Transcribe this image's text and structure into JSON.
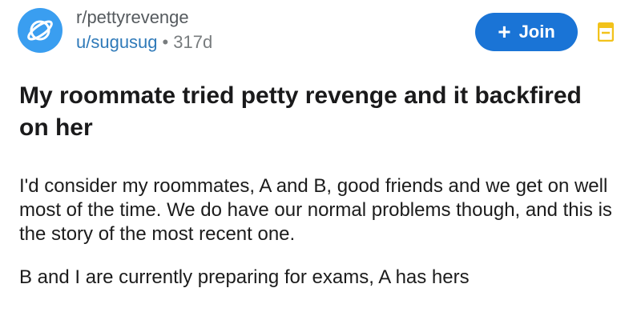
{
  "post": {
    "subreddit": "r/pettyrevenge",
    "username": "u/sugusug",
    "separator": "•",
    "age": "317d",
    "join_label": "Join",
    "title": "My roommate tried petty revenge and it backfired on her",
    "paragraphs": [
      "I'd consider my roommates, A and B, good friends and we get on well most of the time. We do have our normal problems though, and this is the story of the most recent one.",
      "B and I are currently preparing for exams, A has hers"
    ]
  },
  "colors": {
    "avatar": "#3a9ef0",
    "join_button": "#1a74d6",
    "username": "#2f7ab9",
    "more_icon": "#f2c21b"
  },
  "icons": {
    "avatar": "planet-icon",
    "join": "plus-icon",
    "more": "menu-icon"
  }
}
